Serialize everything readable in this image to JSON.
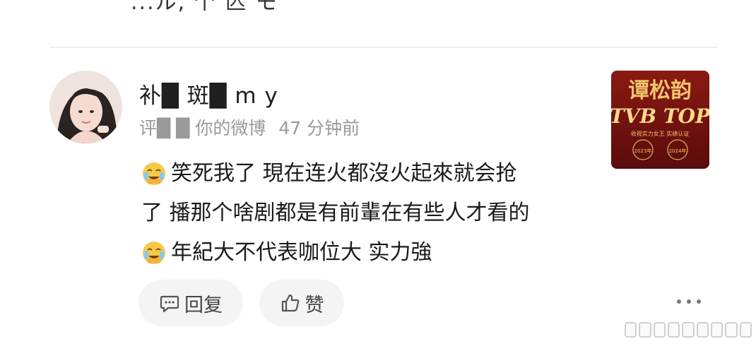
{
  "header": {
    "cut_title": "...ル, 个 兦 モ"
  },
  "comment": {
    "username": "补█ 斑█ m y",
    "action": "评█ █ 你的微博",
    "time": "47 分钟前",
    "lines": [
      {
        "emoji": "crying-laughing",
        "text": "笑死我了 現在连火都沒火起來就会抢"
      },
      {
        "emoji": "",
        "text": "了 播那个啥剧都是有前輩在有些人才看的"
      },
      {
        "emoji": "crying-laughing",
        "text": "年紀大不代表咖位大 实力強"
      }
    ]
  },
  "thumbnail": {
    "title": "谭松韵",
    "subtitle": "TVB TOP",
    "tagline": "收视实力女王 实绩认证",
    "badges": [
      "2023年",
      "2024年"
    ]
  },
  "actions": {
    "reply_label": "回复",
    "like_label": "赞"
  },
  "colors": {
    "text": "#1a1a1a",
    "meta": "#9a9a9a",
    "button_bg": "#f4f4f4",
    "thumb_bg": "#7a1414",
    "thumb_gold": "#f2c56b"
  }
}
